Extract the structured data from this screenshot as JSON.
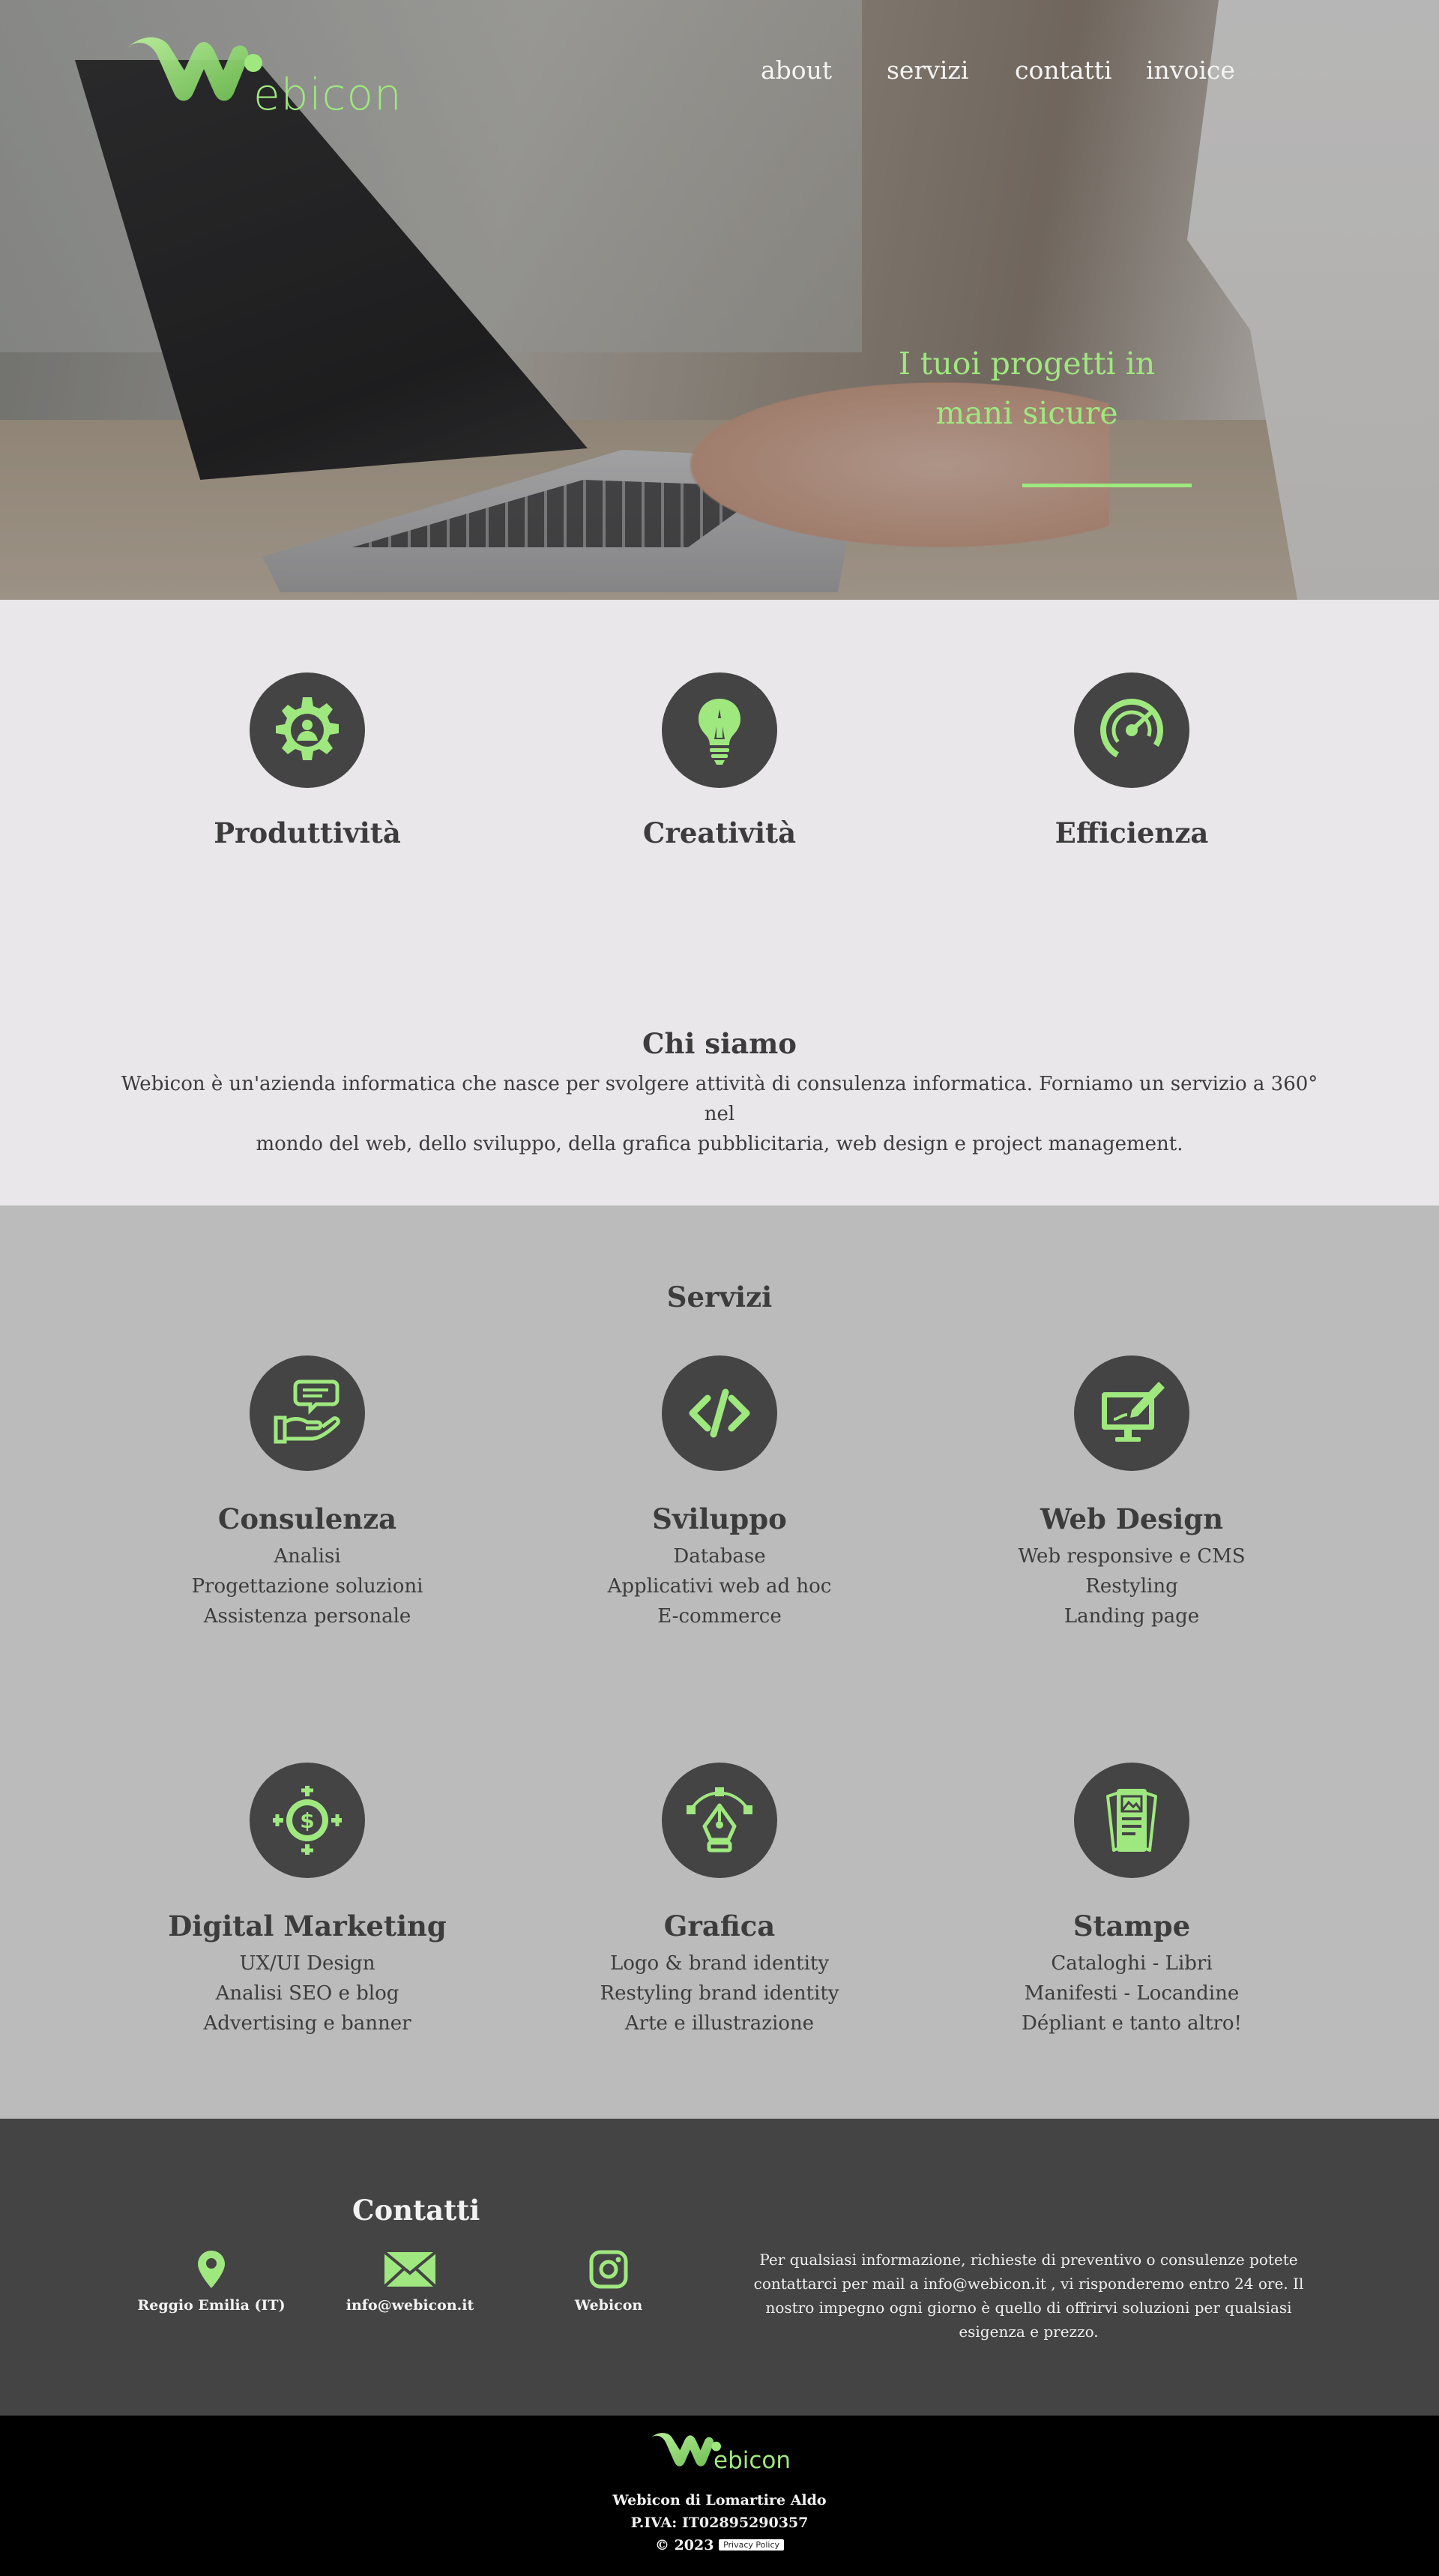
{
  "brand": {
    "logo_text": "ebicon",
    "accent": "#9fe87f",
    "dark": "#444444"
  },
  "nav": {
    "items": [
      "about",
      "servizi",
      "contatti",
      "invoice"
    ]
  },
  "hero": {
    "tagline_line1": "I tuoi progetti in",
    "tagline_line2": "mani sicure"
  },
  "features": [
    {
      "icon": "gear-person-icon",
      "title": "Produttività"
    },
    {
      "icon": "lightbulb-pencil-icon",
      "title": "Creatività"
    },
    {
      "icon": "gauge-icon",
      "title": "Efficienza"
    }
  ],
  "about": {
    "title": "Chi siamo",
    "text_line1": "Webicon è un'azienda informatica che nasce per svolgere attività di consulenza informatica. Forniamo un servizio a 360° nel",
    "text_line2": "mondo del web, dello sviluppo, della grafica pubblicitaria, web design e project management."
  },
  "services": {
    "title": "Servizi",
    "items": [
      {
        "icon": "hand-chat-icon",
        "title": "Consulenza",
        "lines": [
          "Analisi",
          "Progettazione soluzioni",
          "Assistenza personale"
        ]
      },
      {
        "icon": "code-icon",
        "title": "Sviluppo",
        "lines": [
          "Database",
          "Applicativi web ad hoc",
          "E-commerce"
        ]
      },
      {
        "icon": "monitor-brush-icon",
        "title": "Web Design",
        "lines": [
          "Web responsive e CMS",
          "Restyling",
          "Landing page"
        ]
      },
      {
        "icon": "dollar-target-icon",
        "title": "Digital Marketing",
        "lines": [
          "UX/UI Design",
          "Analisi SEO e blog",
          "Advertising e banner"
        ]
      },
      {
        "icon": "pen-tool-icon",
        "title": "Grafica",
        "lines": [
          "Logo & brand identity",
          "Restyling brand identity",
          "Arte e illustrazione"
        ]
      },
      {
        "icon": "print-documents-icon",
        "title": "Stampe",
        "lines": [
          "Cataloghi - Libri",
          "Manifesti - Locandine",
          "Dépliant e tanto altro!"
        ]
      }
    ]
  },
  "contact": {
    "title": "Contatti",
    "location": "Reggio Emilia (IT)",
    "email": "info@webicon.it",
    "instagram": "Webicon",
    "text": "Per qualsiasi informazione, richieste di preventivo o consulenze potete contattarci per mail a info@webicon.it , vi risponderemo entro 24 ore. Il nostro impegno ogni giorno è quello di offrirvi soluzioni per qualsiasi esigenza e prezzo."
  },
  "footer": {
    "logo_text": "ebicon",
    "company": "Webicon di Lomartire Aldo",
    "vat": "P.IVA: IT02895290357",
    "copyright": "© 2023",
    "privacy": "Privacy Policy"
  }
}
